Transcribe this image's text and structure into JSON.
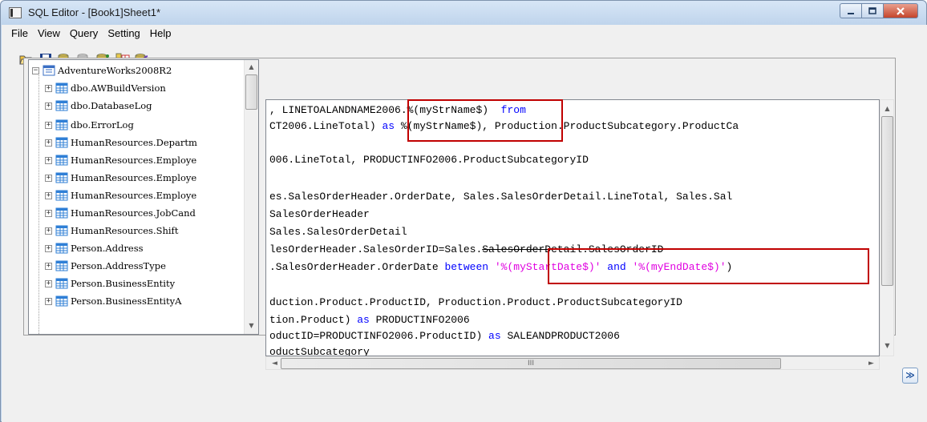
{
  "window": {
    "title": "SQL Editor - [Book1]Sheet1*"
  },
  "menu": [
    "File",
    "View",
    "Query",
    "Setting",
    "Help"
  ],
  "toolbar": {
    "icons": [
      "open-folder-icon",
      "save-icon",
      "execute-query-icon",
      "stop-query-icon",
      "add-table-icon",
      "table-grid-icon",
      "query-builder-icon"
    ]
  },
  "tree": {
    "root": "AdventureWorks2008R2",
    "items": [
      "dbo.AWBuildVersion",
      "dbo.DatabaseLog",
      "dbo.ErrorLog",
      "HumanResources.Departm",
      "HumanResources.Employe",
      "HumanResources.Employe",
      "HumanResources.Employe",
      "HumanResources.JobCand",
      "HumanResources.Shift",
      "Person.Address",
      "Person.AddressType",
      "Person.BusinessEntity",
      "Person.BusinessEntityA"
    ]
  },
  "code": {
    "lines": [
      [
        {
          "t": ", LINETOALANDNAME2006.%(myStrName$) "
        },
        {
          "t": " from",
          "c": "kw"
        }
      ],
      [
        {
          "t": "CT2006.LineTotal) "
        },
        {
          "t": "as",
          "c": "kw"
        },
        {
          "t": " %(myStrName$), Production.ProductSubcategory.ProductCa"
        }
      ],
      [
        {
          "t": ""
        }
      ],
      [
        {
          "t": "006.LineTotal, PRODUCTINFO2006.ProductSubcategoryID"
        }
      ],
      [
        {
          "t": ""
        }
      ],
      [
        {
          "t": "es.SalesOrderHeader.OrderDate, Sales.SalesOrderDetail.LineTotal, Sales.Sal"
        }
      ],
      [
        {
          "t": "SalesOrderHeader"
        }
      ],
      [
        {
          "t": "Sales.SalesOrderDetail"
        }
      ],
      [
        {
          "t": "lesOrderHeader.SalesOrderID=Sales."
        },
        {
          "t": "SalesOrderDetail.SalesOrderID",
          "c": "strike"
        }
      ],
      [
        {
          "t": ".SalesOrderHeader.OrderDate "
        },
        {
          "t": "between",
          "c": "kw"
        },
        {
          "t": " "
        },
        {
          "t": "'%(myStartDate$)'",
          "c": "str"
        },
        {
          "t": " "
        },
        {
          "t": "and",
          "c": "kw"
        },
        {
          "t": " "
        },
        {
          "t": "'%(myEndDate$)'",
          "c": "str"
        },
        {
          "t": ")"
        }
      ],
      [
        {
          "t": ""
        }
      ],
      [
        {
          "t": "duction.Product.ProductID, Production.Product.ProductSubcategoryID"
        }
      ],
      [
        {
          "t": "tion.Product) "
        },
        {
          "t": "as",
          "c": "kw"
        },
        {
          "t": " PRODUCTINFO2006"
        }
      ],
      [
        {
          "t": "oductID=PRODUCTINFO2006.ProductID) "
        },
        {
          "t": "as",
          "c": "kw"
        },
        {
          "t": " SALEANDPRODUCT2006"
        }
      ],
      [
        {
          "t": "oductSubcategory"
        }
      ]
    ]
  },
  "scrollbar": {
    "h_thumb_glyph": "III"
  },
  "expand_button": {
    "glyph": "≫"
  },
  "colors": {
    "keyword": "#0000ff",
    "string": "#e000e0",
    "highlight": "#c00000"
  }
}
